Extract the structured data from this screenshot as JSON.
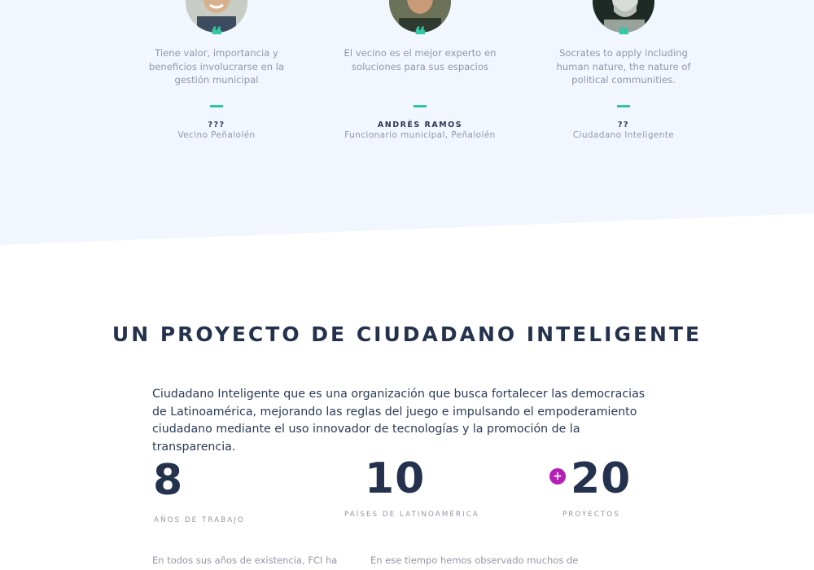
{
  "testimonials": [
    {
      "quote": "Tiene valor, importancia y beneficios involucrarse en la gestión municipal",
      "author": "???",
      "role": "Vecino Peñalolén"
    },
    {
      "quote": "El vecino es el mejor experto en soluciones para sus espacios",
      "author": "ANDRÉS RAMOS",
      "role": "Funcionario municipal, Peñalolén"
    },
    {
      "quote": "Socrates to apply  including human nature, the nature of political communities.",
      "author": "??",
      "role": "Ciudadano Inteligente"
    }
  ],
  "project": {
    "title": "UN PROYECTO DE CIUDADANO INTELIGENTE",
    "intro": "Ciudadano Inteligente que es una organización que busca fortalecer las democracias de Latinoamérica, mejorando las reglas del juego e impulsando el empoderamiento ciudadano mediante el uso innovador de tecnologías y la promoción de la transparencia."
  },
  "stats": [
    {
      "number": "8",
      "label": "AÑOS DE TRABAJO"
    },
    {
      "number": "10",
      "label": "PAÍSES DE LATINOAMÉRICA"
    },
    {
      "number": "20",
      "label": "PROYECTOS",
      "prefix": "+"
    }
  ],
  "columns": [
    "En todos sus años de existencia, FCI ha",
    "En ese tiempo hemos observado muchos de"
  ],
  "colors": {
    "band_background": "#f2f6ff",
    "accent_teal": "#34c7a3",
    "accent_magenta": "#b41fb6",
    "heading": "#24324e",
    "muted_text": "#8f97a8"
  },
  "icons": [
    "quote-icon",
    "plus-icon"
  ]
}
